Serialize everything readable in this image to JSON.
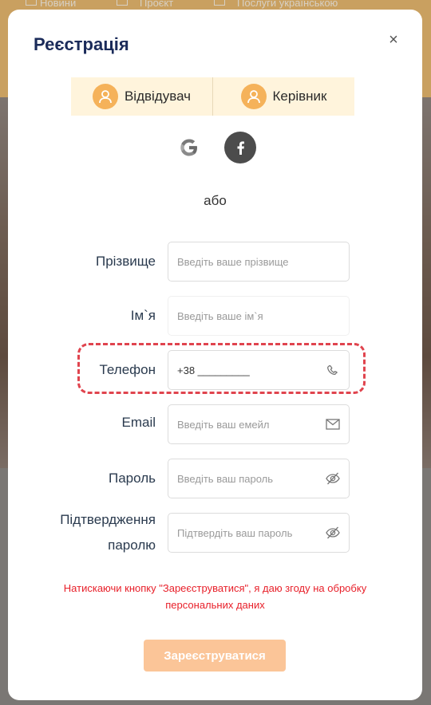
{
  "background_nav": {
    "item1": "Новини",
    "item2": "Проєкт",
    "item3": "Послуги українською"
  },
  "modal": {
    "title": "Реєстрація",
    "close_glyph": "×",
    "roles": [
      {
        "label": "Відвідувач",
        "icon": "user-avatar-icon"
      },
      {
        "label": "Керівник",
        "icon": "user-avatar-icon"
      }
    ],
    "social": {
      "google_icon": "google-icon",
      "facebook_icon": "facebook-icon"
    },
    "or_text": "або",
    "fields": {
      "surname": {
        "label": "Прізвище",
        "placeholder": "Введіть ваше прізвище"
      },
      "name": {
        "label": "Ім`я",
        "placeholder": "Введіть ваше ім`я"
      },
      "phone": {
        "label": "Телефон",
        "value": "+38 _________",
        "icon": "phone-icon"
      },
      "email": {
        "label": "Email",
        "placeholder": "Введіть ваш емейл",
        "icon": "mail-icon"
      },
      "password": {
        "label": "Пароль",
        "placeholder": "Введіть ваш пароль",
        "icon": "eye-off-icon"
      },
      "confirm": {
        "label_line1": "Підтвердження",
        "label_line2": "паролю",
        "placeholder": "Підтвердіть ваш пароль",
        "icon": "eye-off-icon"
      }
    },
    "consent_line1": "Натискаючи кнопку \"Зареєструватися\", я даю згоду на обробку",
    "consent_line2": "персональних даних",
    "submit_label": "Зареєструватися"
  },
  "colors": {
    "title": "#1b2b5a",
    "role_bg": "#fff4dc",
    "avatar": "#f5b25a",
    "consent": "#e8202a",
    "submit_bg": "#fbc598",
    "highlight": "#e0444e"
  }
}
